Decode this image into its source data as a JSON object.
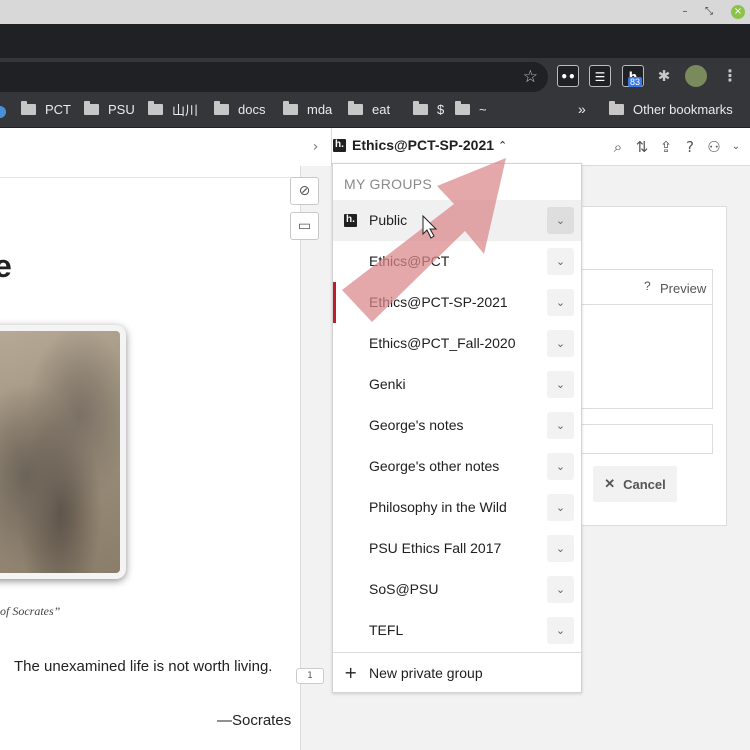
{
  "bookmarks": {
    "items": [
      "PCT",
      "PSU",
      "山川",
      "docs",
      "mda",
      "eat",
      "$",
      "~"
    ],
    "overflow": "»",
    "other": "Other bookmarks"
  },
  "extensions": {
    "badge": "83"
  },
  "article": {
    "heading_fragment": "e",
    "caption": "of Socrates”",
    "quote": "The unexamined life is not worth living.",
    "attribution": "—Socrates",
    "bubble_count": "1"
  },
  "sidebar": {
    "current_group": "Ethics@PCT-SP-2021",
    "logo": "h."
  },
  "groups_menu": {
    "section_title": "MY GROUPS",
    "items": [
      {
        "label": "Public",
        "hover": true
      },
      {
        "label": "Ethics@PCT"
      },
      {
        "label": "Ethics@PCT-SP-2021",
        "current": true
      },
      {
        "label": "Ethics@PCT_Fall-2020"
      },
      {
        "label": "Genki"
      },
      {
        "label": "George's notes"
      },
      {
        "label": "George's other notes"
      },
      {
        "label": "Philosophy in the Wild"
      },
      {
        "label": "PSU Ethics Fall 2017"
      },
      {
        "label": "SoS@PSU"
      },
      {
        "label": "TEFL"
      }
    ],
    "new_group": "New private group"
  },
  "editor": {
    "help": "?",
    "preview": "Preview",
    "cancel": "Cancel"
  },
  "colors": {
    "accent": "#bd1c2b",
    "tutorial_arrow": "#d9868a"
  }
}
